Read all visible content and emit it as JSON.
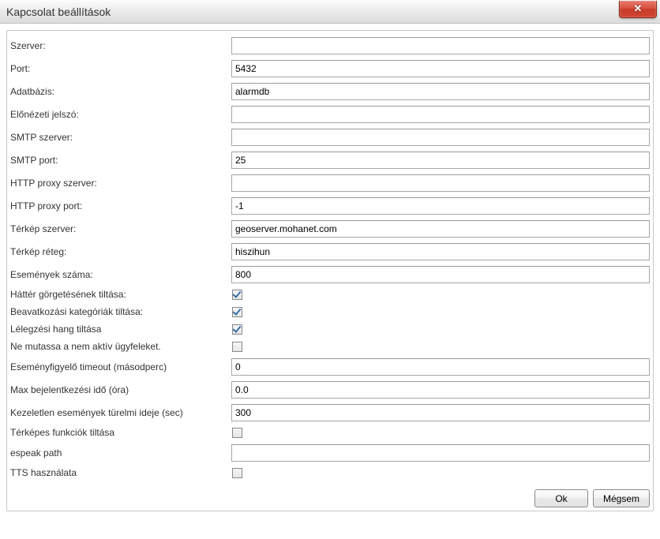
{
  "window": {
    "title": "Kapcsolat beállítások"
  },
  "form": {
    "server": {
      "label": "Szerver:",
      "value": ""
    },
    "port": {
      "label": "Port:",
      "value": "5432"
    },
    "database": {
      "label": "Adatbázis:",
      "value": "alarmdb"
    },
    "preview_password": {
      "label": "Előnézeti jelszó:",
      "value": ""
    },
    "smtp_server": {
      "label": "SMTP szerver:",
      "value": ""
    },
    "smtp_port": {
      "label": "SMTP port:",
      "value": "25"
    },
    "http_proxy_server": {
      "label": "HTTP proxy szerver:",
      "value": ""
    },
    "http_proxy_port": {
      "label": "HTTP proxy port:",
      "value": "-1"
    },
    "map_server": {
      "label": "Térkép szerver:",
      "value": "geoserver.mohanet.com"
    },
    "map_layer": {
      "label": "Térkép réteg:",
      "value": "hiszihun"
    },
    "event_count": {
      "label": "Események száma:",
      "value": "800"
    },
    "disable_bg_scroll": {
      "label": "Háttér görgetésének tiltása:",
      "checked": true
    },
    "disable_intervention_cat": {
      "label": "Beavatkozási kategóriák tiltása:",
      "checked": true
    },
    "disable_breath_sound": {
      "label": "Lélegzési hang tiltása",
      "checked": true
    },
    "hide_inactive_clients": {
      "label": "Ne mutassa a nem aktív ügyfeleket.",
      "checked": false
    },
    "event_monitor_timeout": {
      "label": "Eseményfigyelő timeout (másodperc)",
      "value": "0"
    },
    "max_login_time": {
      "label": "Max bejelentkezési idő (óra)",
      "value": "0.0"
    },
    "unhandled_grace": {
      "label": "Kezeletlen események türelmi ideje (sec)",
      "value": "300"
    },
    "disable_map_functions": {
      "label": "Térképes funkciók tiltása",
      "checked": false
    },
    "espeak_path": {
      "label": "espeak path",
      "value": ""
    },
    "use_tts": {
      "label": "TTS használata",
      "checked": false
    }
  },
  "buttons": {
    "ok": "Ok",
    "cancel": "Mégsem"
  }
}
